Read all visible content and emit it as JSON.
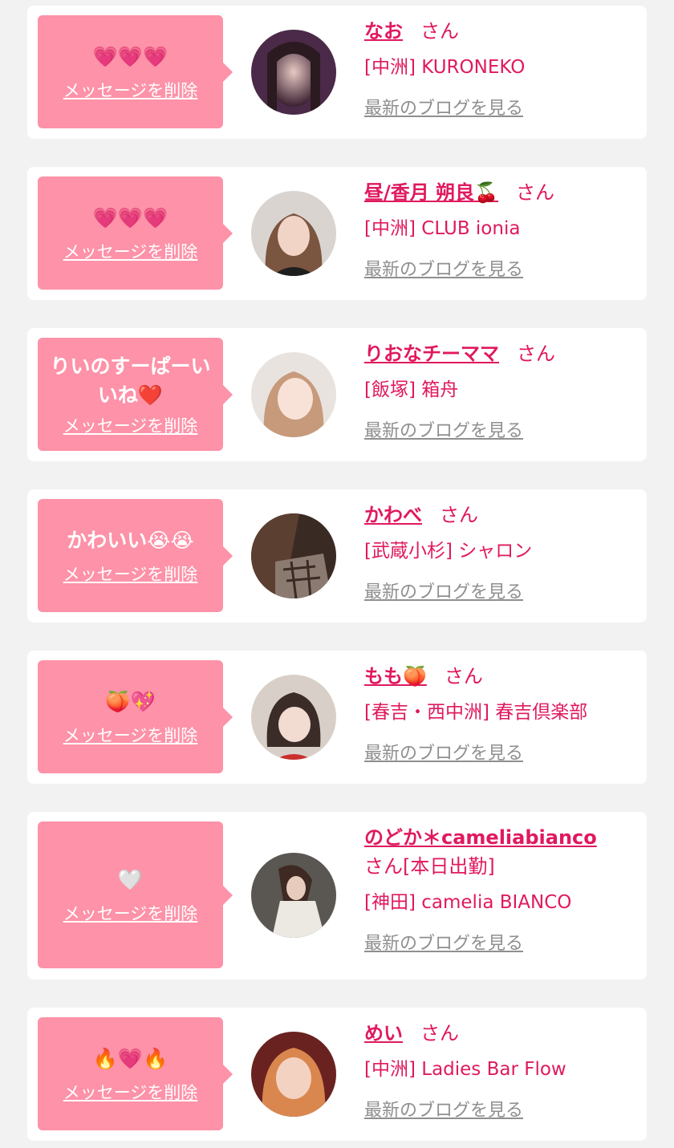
{
  "common": {
    "delete_label": "メッセージを削除",
    "san_label": "さん",
    "blog_label": "最新のブログを見る"
  },
  "colors": {
    "accent": "#e0195f",
    "bubble": "#fd92a8",
    "link_gray": "#8f8f8f",
    "background": "#f2f2f2"
  },
  "cards": [
    {
      "message": "💗💗💗",
      "name": "なお",
      "name_extra": "",
      "shop": "[中洲] KURONEKO"
    },
    {
      "message": "💗💗💗",
      "name": "昼/香月 朔良🍒",
      "name_extra": "",
      "shop": "[中洲] CLUB ionia"
    },
    {
      "message": "りいのすーぱーいいね❤️",
      "name": "りおなチーママ",
      "name_extra": "",
      "shop": "[飯塚] 箱舟"
    },
    {
      "message": "かわいい😭😭",
      "name": "かわべ",
      "name_extra": "",
      "shop": "[武蔵小杉] シャロン"
    },
    {
      "message": "🍑💖",
      "name": "もも🍑",
      "name_extra": "",
      "shop": "[春吉・西中洲] 春吉倶楽部"
    },
    {
      "message": "🤍",
      "name": "のどか＊cameliabianco",
      "name_extra": "[本日出勤]",
      "shop": "[神田] camelia BIANCO"
    },
    {
      "message": "🔥💗🔥",
      "name": "めい",
      "name_extra": "",
      "shop": "[中洲] Ladies Bar Flow"
    }
  ]
}
